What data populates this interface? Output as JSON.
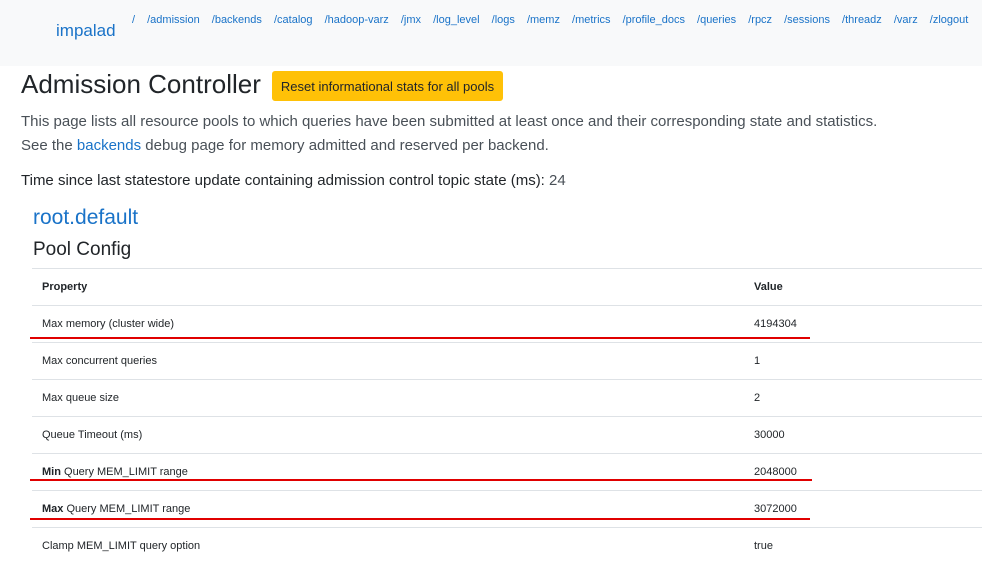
{
  "nav": {
    "brand": "impalad",
    "links": [
      "/",
      "/admission",
      "/backends",
      "/catalog",
      "/hadoop-varz",
      "/jmx",
      "/log_level",
      "/logs",
      "/memz",
      "/metrics",
      "/profile_docs",
      "/queries",
      "/rpcz",
      "/sessions",
      "/threadz",
      "/varz",
      "/zlogout"
    ]
  },
  "header": {
    "title": "Admission Controller",
    "reset_button": "Reset informational stats for all pools"
  },
  "description": {
    "line1": "This page lists all resource pools to which queries have been submitted at least once and their corresponding state and statistics.",
    "line2_prefix": "See the ",
    "line2_link": "backends",
    "line2_suffix": " debug page for memory admitted and reserved per backend."
  },
  "statestore": {
    "label": "Time since last statestore update containing admission control topic state (ms): ",
    "value": "24"
  },
  "pool": {
    "name": "root.default",
    "config_title": "Pool Config",
    "table": {
      "headers": [
        "Property",
        "Value"
      ],
      "rows": [
        {
          "bold": "",
          "label": "Max memory (cluster wide)",
          "value": "4194304"
        },
        {
          "bold": "",
          "label": "Max concurrent queries",
          "value": "1"
        },
        {
          "bold": "",
          "label": "Max queue size",
          "value": "2"
        },
        {
          "bold": "",
          "label": "Queue Timeout (ms)",
          "value": "30000"
        },
        {
          "bold": "Min",
          "label": " Query MEM_LIMIT range",
          "value": "2048000"
        },
        {
          "bold": "Max",
          "label": " Query MEM_LIMIT range",
          "value": "3072000"
        },
        {
          "bold": "",
          "label": "Clamp MEM_LIMIT query option",
          "value": "true"
        }
      ]
    }
  },
  "colors": {
    "link": "#1a73c8",
    "button": "#ffc107",
    "annotation": "#e00000"
  }
}
